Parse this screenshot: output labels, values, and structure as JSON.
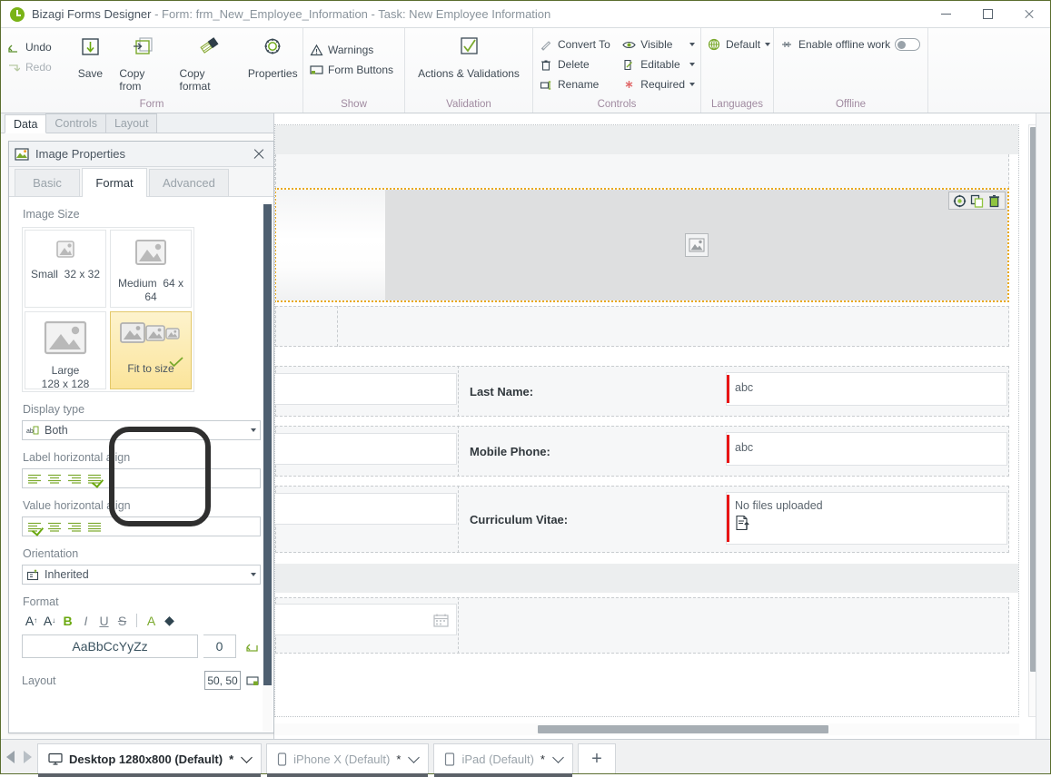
{
  "window": {
    "title_app": "Bizagi Forms Designer",
    "title_form": " - Form: frm_New_Employee_Information - Task:  New Employee Information",
    "minimize": "Minimize",
    "maximize": "Maximize",
    "close": "Close"
  },
  "ribbon": {
    "groups": [
      {
        "label": "Form",
        "small_buttons": [
          {
            "label": "Undo",
            "icon": "undo-icon",
            "enabled": true
          },
          {
            "label": "Redo",
            "icon": "redo-icon",
            "enabled": false
          }
        ],
        "big_buttons": [
          {
            "label": "Save",
            "icon": "save-icon"
          },
          {
            "label": "Copy from",
            "icon": "copy-from-icon"
          },
          {
            "label": "Copy format",
            "icon": "copy-format-icon"
          },
          {
            "label": "Properties",
            "icon": "gear-icon"
          }
        ]
      },
      {
        "label": "Show",
        "items": [
          {
            "label": "Warnings",
            "icon": "warning-triangle-icon"
          },
          {
            "label": "Form Buttons",
            "icon": "form-buttons-icon"
          }
        ]
      },
      {
        "label": "Validation",
        "items": [
          {
            "label": "Actions & Validations",
            "icon": "checkmark-box-icon"
          }
        ]
      },
      {
        "label": "Controls",
        "col1": [
          {
            "label": "Convert To",
            "icon": "convert-icon"
          },
          {
            "label": "Delete",
            "icon": "trash-icon"
          },
          {
            "label": "Rename",
            "icon": "rename-icon"
          }
        ],
        "col2": [
          {
            "label": "Visible",
            "icon": "eye-icon",
            "dropdown": true
          },
          {
            "label": "Editable",
            "icon": "pencil-page-icon",
            "dropdown": true
          },
          {
            "label": "Required",
            "icon": "asterisk-icon",
            "dropdown": true
          }
        ]
      },
      {
        "label": "Languages",
        "items": [
          {
            "label": "Default",
            "icon": "globe-icon",
            "dropdown": true
          }
        ]
      },
      {
        "label": "Offline",
        "items": [
          {
            "label": "Enable offline work",
            "icon": "offline-icon",
            "toggle": "off"
          }
        ]
      }
    ]
  },
  "left_panel": {
    "tabs": [
      {
        "label": "Data",
        "active": true
      },
      {
        "label": "Controls",
        "active": false
      },
      {
        "label": "Layout",
        "active": false
      }
    ],
    "dialog": {
      "title": "Image Properties",
      "icon": "image-properties-icon",
      "close_label": "Close",
      "tabs": [
        {
          "label": "Basic",
          "active": false
        },
        {
          "label": "Format",
          "active": true
        },
        {
          "label": "Advanced",
          "active": false
        }
      ],
      "image_size": {
        "section_label": "Image Size",
        "options": [
          {
            "name": "Small",
            "dims": "32 x 32",
            "selected": false,
            "icon": "image-small-icon"
          },
          {
            "name": "Medium",
            "dims": "64 x 64",
            "selected": false,
            "icon": "image-medium-icon"
          },
          {
            "name": "Large",
            "dims": "128 x 128",
            "selected": false,
            "icon": "image-large-icon"
          },
          {
            "name": "Fit to size",
            "dims": "",
            "selected": true,
            "icon": "image-fit-icon"
          }
        ]
      },
      "display_type": {
        "label": "Display type",
        "value": "Both",
        "icon": "display-both-icon"
      },
      "label_horizontal_align": {
        "label": "Label horizontal align",
        "selected_index": 3,
        "options": [
          "align-left",
          "align-center",
          "align-right",
          "align-justify"
        ]
      },
      "value_horizontal_align": {
        "label": "Value horizontal align",
        "selected_index": 0,
        "options": [
          "align-left",
          "align-center",
          "align-right",
          "align-justify"
        ]
      },
      "orientation": {
        "label": "Orientation",
        "value": "Inherited",
        "icon": "orientation-icon"
      },
      "format": {
        "label": "Format",
        "buttons": [
          {
            "name": "increase-font-size",
            "glyph": "A"
          },
          {
            "name": "decrease-font-size",
            "glyph": "A"
          },
          {
            "name": "bold",
            "glyph": "B"
          },
          {
            "name": "italic",
            "glyph": "I"
          },
          {
            "name": "underline",
            "glyph": "U"
          },
          {
            "name": "strikethrough",
            "glyph": "S"
          },
          {
            "name": "font-color",
            "glyph": "A"
          },
          {
            "name": "fill-color",
            "glyph": "◆"
          }
        ],
        "preview_text": "AaBbCcYyZz",
        "size_value": "0",
        "reset_icon": "reset-format-icon"
      },
      "layout": {
        "label": "Layout",
        "value": "50, 50",
        "icon": "layout-picker-icon"
      }
    }
  },
  "canvas": {
    "selected_control_toolbar": [
      {
        "name": "properties-gear-icon",
        "label": "Properties"
      },
      {
        "name": "duplicate-icon",
        "label": "Duplicate"
      },
      {
        "name": "delete-trash-icon",
        "label": "Delete"
      }
    ],
    "image_control": {
      "placeholder_icon": "image-placeholder-icon",
      "selected": true
    },
    "fields": [
      {
        "label": "Last Name:",
        "value": "abc",
        "required": true,
        "type": "text"
      },
      {
        "label": "Mobile Phone:",
        "value": "abc",
        "required": true,
        "type": "text"
      },
      {
        "label": "Curriculum Vitae:",
        "value": "No files uploaded",
        "required": true,
        "type": "file",
        "icon": "upload-file-icon"
      }
    ],
    "date_field": {
      "icon": "calendar-icon"
    }
  },
  "bottom_tabs": {
    "prev_label": "Previous",
    "next_label": "Next",
    "tabs": [
      {
        "label": "Desktop 1280x800 (Default)",
        "modified": "*",
        "icon": "monitor-icon",
        "active": true
      },
      {
        "label": "iPhone X (Default)",
        "modified": "*",
        "icon": "phone-icon",
        "active": false
      },
      {
        "label": "iPad (Default)",
        "modified": "*",
        "icon": "tablet-icon",
        "active": false
      }
    ],
    "add_label": "+"
  },
  "colors": {
    "accent_green": "#7ab317",
    "selection_orange": "#e8a91e",
    "required_red": "#e81414",
    "group_label": "#a08aa0",
    "highlight_ring": "#2f2f2f"
  }
}
